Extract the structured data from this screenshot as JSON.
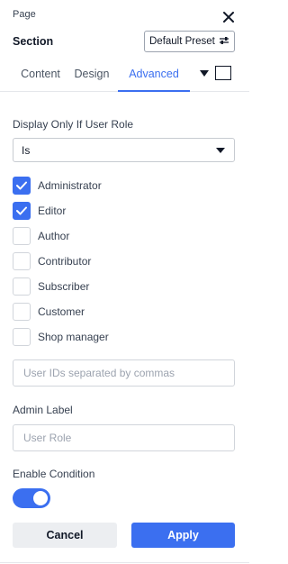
{
  "header": {
    "breadcrumb": "Page",
    "section_title": "Section",
    "preset_label": "Default Preset",
    "close_icon": "close-icon",
    "preset_icon": "sliders-icon"
  },
  "tabs": [
    {
      "label": "Content",
      "active": false
    },
    {
      "label": "Design",
      "active": false
    },
    {
      "label": "Advanced",
      "active": true
    }
  ],
  "tab_actions": {
    "dropdown_icon": "caret-down-icon",
    "layout_icon": "square-icon"
  },
  "condition": {
    "label": "Display Only If User Role",
    "operator": "Is",
    "roles": [
      {
        "label": "Administrator",
        "checked": true
      },
      {
        "label": "Editor",
        "checked": true
      },
      {
        "label": "Author",
        "checked": false
      },
      {
        "label": "Contributor",
        "checked": false
      },
      {
        "label": "Subscriber",
        "checked": false
      },
      {
        "label": "Customer",
        "checked": false
      },
      {
        "label": "Shop manager",
        "checked": false
      }
    ],
    "user_ids": {
      "value": "",
      "placeholder": "User IDs separated by commas"
    }
  },
  "admin_label": {
    "label": "Admin Label",
    "value": "",
    "placeholder": "User Role"
  },
  "enable_condition": {
    "label": "Enable Condition",
    "enabled": true
  },
  "actions": {
    "cancel_label": "Cancel",
    "apply_label": "Apply"
  },
  "colors": {
    "accent": "#3b6ff0",
    "muted_button": "#eceef1"
  }
}
